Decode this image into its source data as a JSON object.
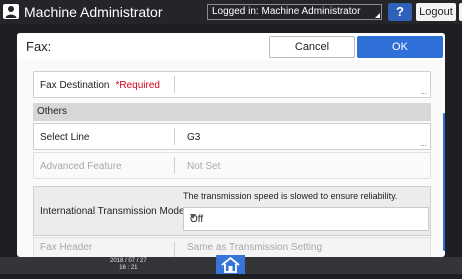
{
  "header": {
    "title": "Machine Administrator",
    "logged_in": "Logged in: Machine Administrator",
    "help_label": "?",
    "logout_label": "Logout"
  },
  "dialog": {
    "title": "Fax:",
    "cancel_label": "Cancel",
    "ok_label": "OK",
    "fax_destination": {
      "label": "Fax Destination",
      "required": "*Required",
      "value": ""
    },
    "section_others": "Others",
    "select_line": {
      "label": "Select Line",
      "value": "G3"
    },
    "advanced_feature": {
      "label": "Advanced Feature",
      "value": "Not Set"
    },
    "international_mode": {
      "label": "International Transmission Mode",
      "note": "The transmission speed is slowed to ensure reliability.",
      "selected": "Off"
    },
    "fax_header": {
      "label": "Fax Header",
      "value": "Same as Transmission Setting"
    }
  },
  "footer": {
    "date": "2018 / 07 / 27",
    "time": "16 : 21"
  },
  "colors": {
    "accent": "#2e6fd8",
    "required": "#d0021b",
    "topbar": "#242529"
  },
  "icons": [
    "user-icon",
    "help-icon",
    "moon-icon",
    "dropdown-caret-icon",
    "home-icon"
  ]
}
